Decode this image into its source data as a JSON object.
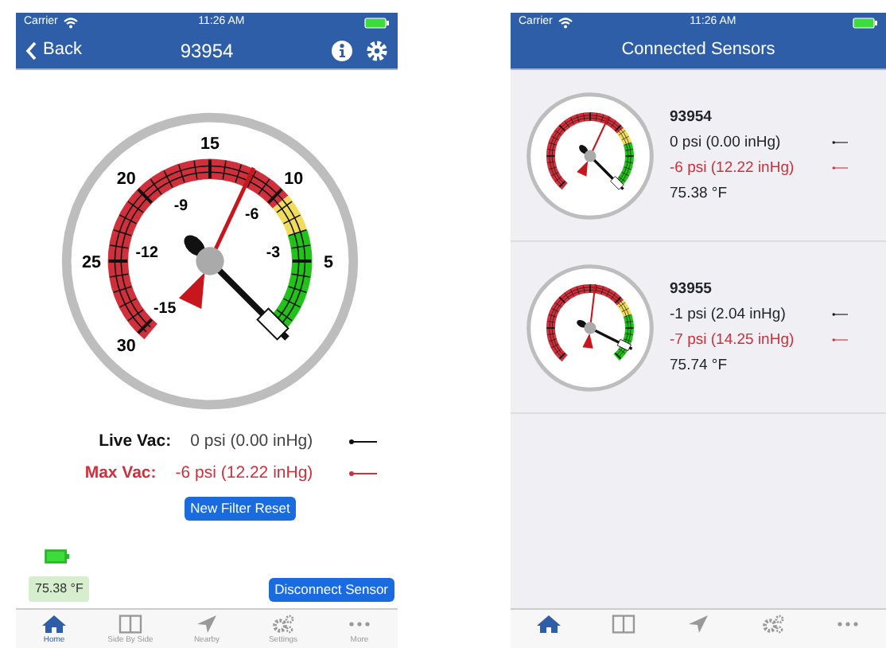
{
  "detail_screen": {
    "status_bar": {
      "carrier": "Carrier",
      "time": "11:26 AM"
    },
    "nav_bar": {
      "back": "Back",
      "title": "93954"
    },
    "gauge": {
      "outer_labels": [
        "30",
        "25",
        "20",
        "15",
        "10",
        "5"
      ],
      "inner_labels": [
        "-15",
        "-12",
        "-9",
        "-6",
        "-3"
      ]
    },
    "readings": [
      {
        "kind": "live",
        "label": "Live Vac:",
        "value": "0 psi (0.00 inHg)"
      },
      {
        "kind": "max",
        "label": "Max Vac:",
        "value": "-6 psi (12.22 inHg)"
      }
    ],
    "reset_button": "New Filter Reset",
    "temperature": "75.38 °F",
    "disconnect_button": "Disconnect Sensor",
    "tabs": [
      {
        "kind": "home",
        "label": "Home",
        "selected": true
      },
      {
        "kind": "split",
        "label": "Side By Side",
        "selected": false
      },
      {
        "kind": "nearby",
        "label": "Nearby",
        "selected": false
      },
      {
        "kind": "settings",
        "label": "Settings",
        "selected": false
      },
      {
        "kind": "more",
        "label": "More",
        "selected": false
      }
    ]
  },
  "list_screen": {
    "status_bar": {
      "carrier": "Carrier",
      "time": "11:26 AM"
    },
    "title": "Connected Sensors",
    "sensors": [
      {
        "name": "93954",
        "live": "0 psi (0.00 inHg)",
        "max": "-6 psi (12.22 inHg)",
        "temperature": "75.38 °F"
      },
      {
        "name": "93955",
        "live": "-1 psi (2.04 inHg)",
        "max": "-7 psi (14.25 inHg)",
        "temperature": "75.74 °F"
      }
    ],
    "tabs": [
      {
        "kind": "home",
        "selected": true
      },
      {
        "kind": "split",
        "selected": false
      },
      {
        "kind": "nearby",
        "selected": false
      },
      {
        "kind": "settings",
        "selected": false
      },
      {
        "kind": "more",
        "selected": false
      }
    ]
  }
}
